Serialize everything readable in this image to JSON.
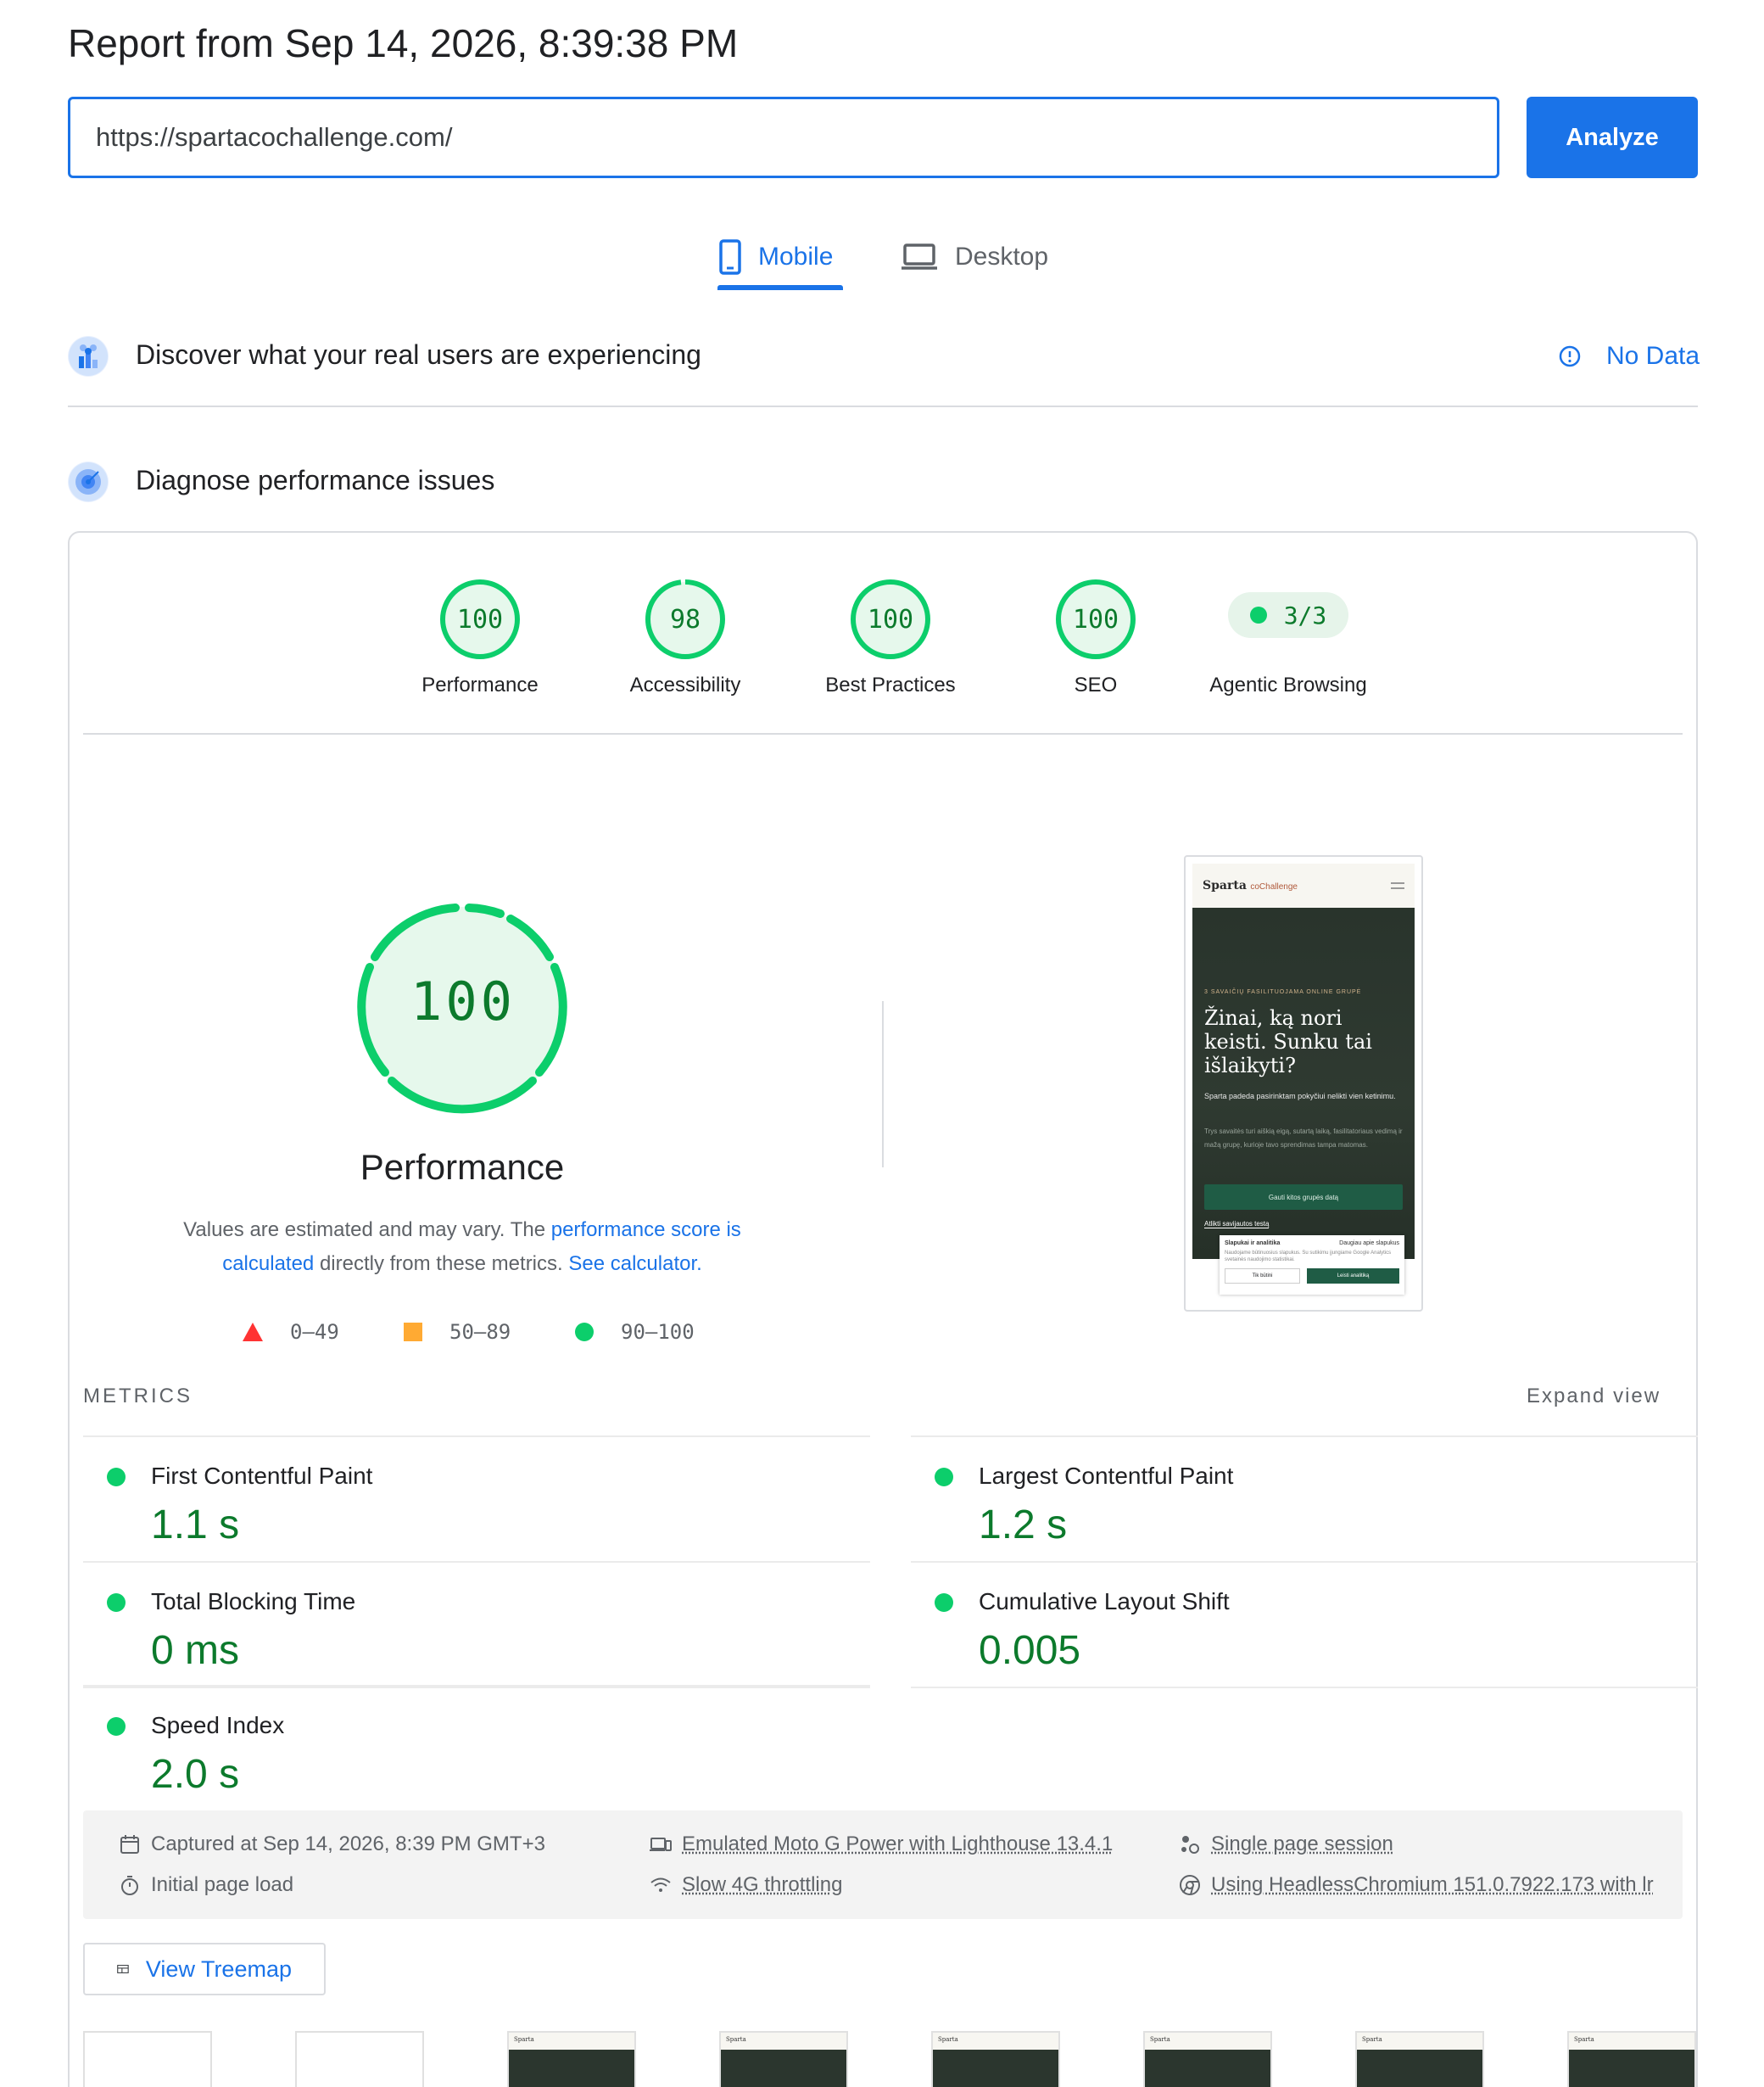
{
  "header": {
    "title": "Report from Sep 14, 2026, 8:39:38 PM",
    "url_value": "https://spartacochallenge.com/",
    "analyze_label": "Analyze"
  },
  "tabs": [
    {
      "label": "Mobile",
      "active": true
    },
    {
      "label": "Desktop",
      "active": false
    }
  ],
  "field_data": {
    "title": "Discover what your real users are experiencing",
    "status": "No Data"
  },
  "diagnose": {
    "title": "Diagnose performance issues"
  },
  "categories": [
    {
      "label": "Performance",
      "score": "100",
      "fraction": 1.0
    },
    {
      "label": "Accessibility",
      "score": "98",
      "fraction": 0.98
    },
    {
      "label": "Best Practices",
      "score": "100",
      "fraction": 1.0
    },
    {
      "label": "SEO",
      "score": "100",
      "fraction": 1.0
    },
    {
      "label": "Agentic Browsing",
      "score": "3/3"
    }
  ],
  "performance": {
    "score": "100",
    "title": "Performance",
    "desc_prefix": "Values are estimated and may vary. The ",
    "desc_link1": "performance score is calculated",
    "desc_mid": " directly from these metrics. ",
    "desc_link2": "See calculator.",
    "legend": [
      "0–49",
      "50–89",
      "90–100"
    ]
  },
  "screenshot": {
    "brand": "Sparta",
    "brand_sub": "coChallenge",
    "kicker": "3 SAVAIČIŲ FASILITUOJAMA ONLINE GRUPĖ",
    "headline": "Žinai, ką nori keisti. Sunku tai išlaikyti?",
    "sub": "Sparta padeda pasirinktam pokyčiui nelikti vien ketinimu.",
    "sub2": "Trys savaitės turi aiškią eigą, sutartą laiką, fasilitatoriaus vedimą ir mažą grupę, kurioje tavo sprendimas tampa matomas.",
    "cta": "Gauti kitos grupės datą",
    "link": "Atlikti savijautos testą",
    "cookie_title": "Slapukai ir analitika",
    "cookie_link": "Daugiau apie slapukus",
    "cookie_text": "Naudojame būtinuosius slapukus. Su sutikimu įjungiame Google Analytics svetainės naudojimo statistikai.",
    "cookie_btn1": "Tik būtini",
    "cookie_btn2": "Leisti analitiką"
  },
  "metrics": {
    "label": "METRICS",
    "expand": "Expand view",
    "items": [
      {
        "name": "First Contentful Paint",
        "value": "1.1 s"
      },
      {
        "name": "Largest Contentful Paint",
        "value": "1.2 s"
      },
      {
        "name": "Total Blocking Time",
        "value": "0 ms"
      },
      {
        "name": "Cumulative Layout Shift",
        "value": "0.005"
      },
      {
        "name": "Speed Index",
        "value": "2.0 s"
      }
    ]
  },
  "runtime": {
    "captured": "Captured at Sep 14, 2026, 8:39 PM GMT+3",
    "load": "Initial page load",
    "device": "Emulated Moto G Power with Lighthouse 13.4.1",
    "throttle": "Slow 4G throttling",
    "session": "Single page session",
    "browser": "Using HeadlessChromium 151.0.7922.173 with lr"
  },
  "treemap_label": "View Treemap",
  "filmstrip_brand": "Sparta",
  "colors": {
    "accent": "#1a73e8",
    "pass": "#0cce6b",
    "pass_text": "#0c7a2c",
    "average": "#ffaa33",
    "fail": "#ff3333"
  }
}
